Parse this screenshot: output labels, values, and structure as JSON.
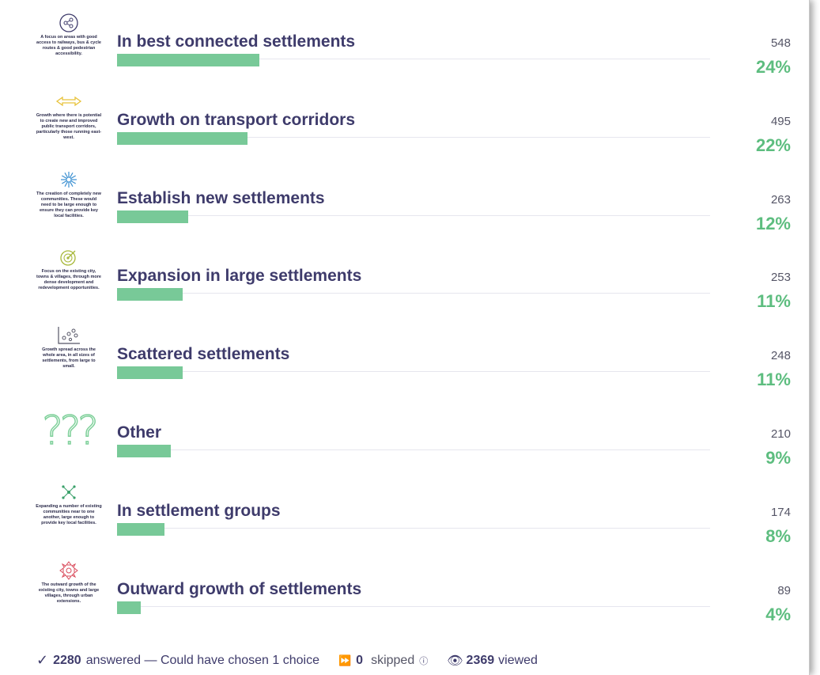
{
  "options": [
    {
      "label": "In best connected settlements",
      "count": "548",
      "percent": "24%",
      "share": 0.24,
      "caption": "A focus on areas with good access to railways, bus & cycle routes & good pedestrian accessibility.",
      "icon": "network-icon",
      "color": "#3e3b6b"
    },
    {
      "label": "Growth on transport corridors",
      "count": "495",
      "percent": "22%",
      "share": 0.22,
      "caption": "Growth where there is potential to create new and improved public transport corridors, particularly those running east-west.",
      "icon": "double-arrow-icon",
      "color": "#e8c23a"
    },
    {
      "label": "Establish new settlements",
      "count": "263",
      "percent": "12%",
      "share": 0.12,
      "caption": "The creation of completely new communities. These would need to be large enough to ensure they can provide key local facilities.",
      "icon": "starburst-icon",
      "color": "#3a8fd1"
    },
    {
      "label": "Expansion in large settlements",
      "count": "253",
      "percent": "11%",
      "share": 0.11,
      "caption": "Focus on the existing city, towns & villages, through more dense development and redevelopment opportunities.",
      "icon": "target-icon",
      "color": "#a8b83a"
    },
    {
      "label": "Scattered settlements",
      "count": "248",
      "percent": "11%",
      "share": 0.11,
      "caption": "Growth spread across the whole area, in all sizes of settlements, from large to small.",
      "icon": "scatter-plot-icon",
      "color": "#555566"
    },
    {
      "label": "Other",
      "count": "210",
      "percent": "9%",
      "share": 0.09,
      "caption": "",
      "icon": "question-marks-icon",
      "color": "#7fd09a"
    },
    {
      "label": "In settlement groups",
      "count": "174",
      "percent": "8%",
      "share": 0.08,
      "caption": "Expanding a number of existing communities near to one another, large enough to provide key local facilities.",
      "icon": "cluster-icon",
      "color": "#3aa06a"
    },
    {
      "label": "Outward growth of settlements",
      "count": "89",
      "percent": "4%",
      "share": 0.04,
      "caption": "The outward growth of the existing city, towns and large villages, through urban extensions.",
      "icon": "outward-arrows-icon",
      "color": "#d94a5a"
    }
  ],
  "colors": {
    "bar": "#78c998",
    "percent": "#5dbd7f",
    "label": "#3e3b6b"
  },
  "footer": {
    "answered_count": "2280",
    "answered_text": "answered — Could have chosen 1 choice",
    "skipped_count": "0",
    "skipped_text": "skipped",
    "viewed_count": "2369",
    "viewed_text": "viewed"
  }
}
